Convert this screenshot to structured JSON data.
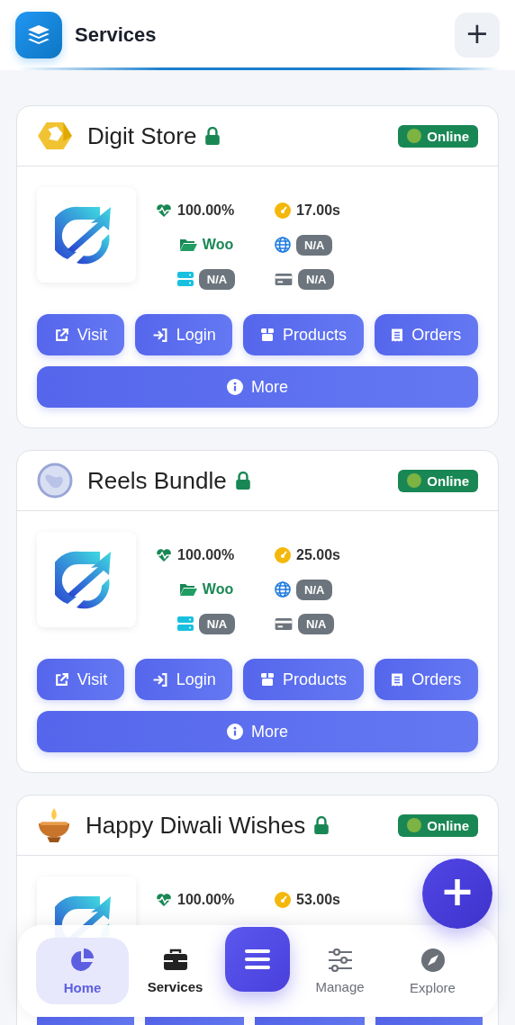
{
  "header": {
    "title": "Services",
    "add_label": "+"
  },
  "services": [
    {
      "name": "Digit Store",
      "locked": true,
      "status": {
        "label": "Online",
        "color": "#7cb342"
      },
      "stats": [
        {
          "kind": "uptime",
          "value": "100.00%"
        },
        {
          "kind": "speed",
          "value": "17.00s"
        },
        {
          "kind": "platform",
          "value": "Woo"
        },
        {
          "kind": "domain",
          "value": "N/A"
        },
        {
          "kind": "server",
          "value": "N/A"
        },
        {
          "kind": "payment",
          "value": "N/A"
        }
      ],
      "actions": [
        {
          "label": "Visit",
          "kind": "external"
        },
        {
          "label": "Login",
          "kind": "login"
        },
        {
          "label": "Products",
          "kind": "box"
        },
        {
          "label": "Orders",
          "kind": "receipt"
        }
      ],
      "more": "More"
    },
    {
      "name": "Reels Bundle",
      "locked": true,
      "status": {
        "label": "Online",
        "color": "#7cb342"
      },
      "stats": [
        {
          "kind": "uptime",
          "value": "100.00%"
        },
        {
          "kind": "speed",
          "value": "25.00s"
        },
        {
          "kind": "platform",
          "value": "Woo"
        },
        {
          "kind": "domain",
          "value": "N/A"
        },
        {
          "kind": "server",
          "value": "N/A"
        },
        {
          "kind": "payment",
          "value": "N/A"
        }
      ],
      "actions": [
        {
          "label": "Visit",
          "kind": "external"
        },
        {
          "label": "Login",
          "kind": "login"
        },
        {
          "label": "Products",
          "kind": "box"
        },
        {
          "label": "Orders",
          "kind": "receipt"
        }
      ],
      "more": "More"
    },
    {
      "name": "Happy Diwali Wishes",
      "locked": true,
      "status": {
        "label": "Online",
        "color": "#7cb342"
      },
      "stats": [
        {
          "kind": "uptime",
          "value": "100.00%"
        },
        {
          "kind": "speed",
          "value": "53.00s"
        }
      ],
      "actions": [
        {
          "kind": "cut"
        },
        {
          "kind": "cut"
        },
        {
          "kind": "cut"
        },
        {
          "kind": "cut"
        }
      ]
    }
  ],
  "fab": {
    "label": "+"
  },
  "nav": [
    {
      "label": "Home",
      "kind": "pie",
      "selected": true
    },
    {
      "label": "Services",
      "kind": "briefcase",
      "selected": false
    },
    {
      "kind": "menu"
    },
    {
      "label": "Manage",
      "kind": "sliders",
      "selected": false
    },
    {
      "label": "Explore",
      "kind": "compass",
      "selected": false
    }
  ]
}
